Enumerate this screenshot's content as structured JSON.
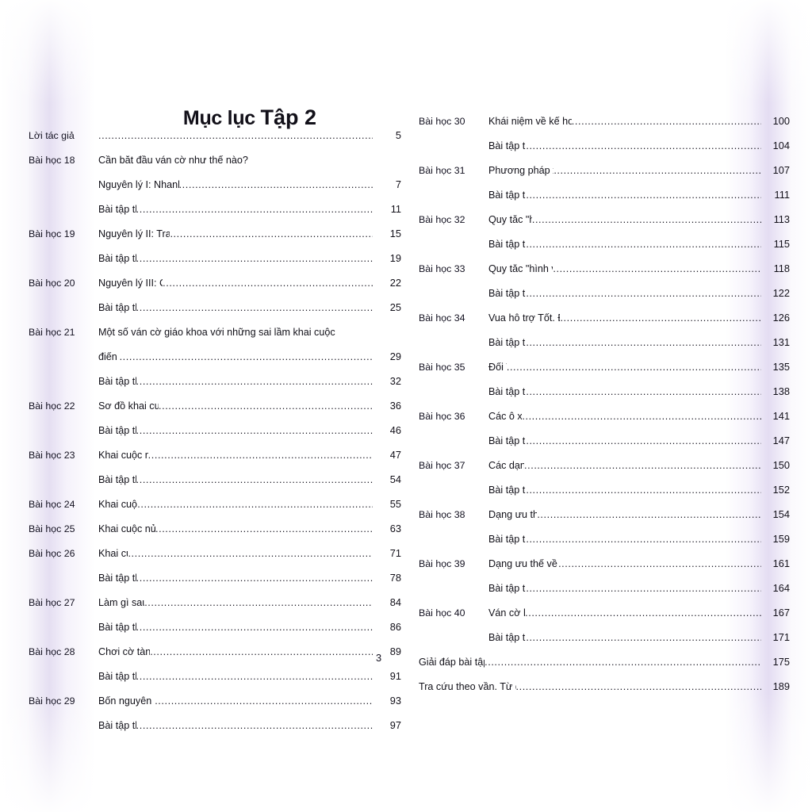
{
  "page": {
    "title_main": "Mục lục",
    "title_volume": "Tập 2",
    "folio": "3"
  },
  "left_column": [
    {
      "label": "Lời tác giả",
      "title": "",
      "page": "5",
      "leader": true,
      "full_label": true
    },
    {
      "label": "Bài học 18",
      "title": "Cần bắt đầu ván cờ như thế nào?",
      "page": "",
      "leader": false
    },
    {
      "label": "",
      "title": "Nguyên lý I: Nhanh chóng phát triển lực lượng",
      "page": "7",
      "leader": true
    },
    {
      "label": "",
      "title": "Bài tập thực hành",
      "page": "11",
      "leader": true
    },
    {
      "label": "Bài học 19",
      "title": "Nguyên lý II: Tranh giành khu trung tâm",
      "page": "15",
      "leader": true
    },
    {
      "label": "",
      "title": "Bài tập thực hành",
      "page": "19",
      "leader": true
    },
    {
      "label": "Bài học 20",
      "title": "Nguyên lý III: Cấu trúc Tốt hài hòa",
      "page": "22",
      "leader": true
    },
    {
      "label": "",
      "title": "Bài tập thực hành",
      "page": "25",
      "leader": true
    },
    {
      "label": "Bài học 21",
      "title": "Một số ván cờ giáo khoa với những sai lầm khai cuộc",
      "page": "",
      "leader": false
    },
    {
      "label": "",
      "title": "điển hình",
      "page": "29",
      "leader": true
    },
    {
      "label": "",
      "title": "Bài tập thực hành",
      "page": "32",
      "leader": true
    },
    {
      "label": "Bài học 22",
      "title": "Sơ đồ khai cuộc. Khai cuộc mở",
      "page": "36",
      "leader": true
    },
    {
      "label": "",
      "title": "Bài tập thực hành",
      "page": "46",
      "leader": true
    },
    {
      "label": "Bài học 23",
      "title": "Khai cuộc mở (tiếp theo)",
      "page": "47",
      "leader": true
    },
    {
      "label": "",
      "title": "Bài tập thực hành",
      "page": "54",
      "leader": true
    },
    {
      "label": "Bài học 24",
      "title": "Khai cuộc nửa mở",
      "page": "55",
      "leader": true
    },
    {
      "label": "Bài học 25",
      "title": "Khai cuộc nửa mở (tiếp theo)",
      "page": "63",
      "leader": true
    },
    {
      "label": "Bài học 26",
      "title": "Khai cuộc kín",
      "page": "71",
      "leader": true
    },
    {
      "label": "",
      "title": "Bài tập thực hành",
      "page": "78",
      "leader": true
    },
    {
      "label": "Bài học 27",
      "title": "Làm gì sau khai cuộc?",
      "page": "84",
      "leader": true
    },
    {
      "label": "",
      "title": "Bài tập thực hành",
      "page": "86",
      "leader": true
    },
    {
      "label": "Bài học 28",
      "title": "Chơi cờ tàn như thế nào?",
      "page": "89",
      "leader": true
    },
    {
      "label": "",
      "title": "Bài tập thực hành ",
      "page": "91",
      "leader": true
    },
    {
      "label": "Bài học 29",
      "title": "Bốn nguyên lý cờ tàn cơ bản",
      "page": "93",
      "leader": true
    },
    {
      "label": "",
      "title": "Bài tập thực hành",
      "page": "97",
      "leader": true
    }
  ],
  "right_column": [
    {
      "label": "Bài học 30",
      "title": "Khái niệm về kế hoạch. Xử lý ưu thế vật chất lớn",
      "page": "100",
      "leader": true
    },
    {
      "label": "",
      "title": "Bài tập thực hành",
      "page": "104",
      "leader": true
    },
    {
      "label": "Bài học 31",
      "title": "Phương pháp xử lý ưu thế vật chất",
      "page": "107",
      "leader": true
    },
    {
      "label": "",
      "title": "Bài tập thực hành",
      "page": "111",
      "leader": true
    },
    {
      "label": "Bài học 32",
      "title": "Quy tắc \"hình vuông\"",
      "page": "113",
      "leader": true
    },
    {
      "label": "",
      "title": "Bài tập thực hành",
      "page": "115",
      "leader": true
    },
    {
      "label": "Bài học 33",
      "title": "Quy tắc \"hình vuông\" trong thực tế",
      "page": "118",
      "leader": true
    },
    {
      "label": "",
      "title": "Bài tập thực hành",
      "page": "122",
      "leader": true
    },
    {
      "label": "Bài học 34",
      "title": "Vua hỗ trợ Tốt. Đôi điều về các Tốt biên",
      "page": "126",
      "leader": true
    },
    {
      "label": "",
      "title": "Bài tập thực hành",
      "page": "131",
      "leader": true
    },
    {
      "label": "Bài học 35",
      "title": "Đổi Vua ",
      "page": "135",
      "leader": true
    },
    {
      "label": "",
      "title": "Bài tập thực hành",
      "page": "138",
      "leader": true
    },
    {
      "label": "Bài học 36",
      "title": "Các ô xung yếu",
      "page": "141",
      "leader": true
    },
    {
      "label": "",
      "title": "Bài tập thực hành",
      "page": "147",
      "leader": true
    },
    {
      "label": "Bài học 37",
      "title": "Các dạng ưu thế",
      "page": "150",
      "leader": true
    },
    {
      "label": "",
      "title": "Bài tập thực hành",
      "page": "152",
      "leader": true
    },
    {
      "label": "Bài học 38",
      "title": "Dạng ưu thế không gian ",
      "page": "154",
      "leader": true
    },
    {
      "label": "",
      "title": "Bài tập thực hành",
      "page": "159",
      "leader": true
    },
    {
      "label": "Bài học 39",
      "title": "Dạng ưu thế về thời gian. An toàn Vua",
      "page": "161",
      "leader": true
    },
    {
      "label": "",
      "title": "Bài tập thực hành",
      "page": "164",
      "leader": true
    },
    {
      "label": "Bài học 40",
      "title": "Ván cờ hoàn hảo",
      "page": "167",
      "leader": true
    },
    {
      "label": "",
      "title": "Bài tập thực hành",
      "page": "171",
      "leader": true
    },
    {
      "label": "",
      "title": "Giải đáp bài tập thực hành",
      "page": "175",
      "leader": true,
      "full_width": true
    },
    {
      "label": "",
      "title": "Tra cứu theo vần. Từ điển thuật ngữ cờ Vua",
      "page": "189",
      "leader": true,
      "full_width": true
    }
  ],
  "colors": {
    "ink": "#121019",
    "page_background": "#ffffff",
    "gutter_shade": "#ded6ee"
  }
}
